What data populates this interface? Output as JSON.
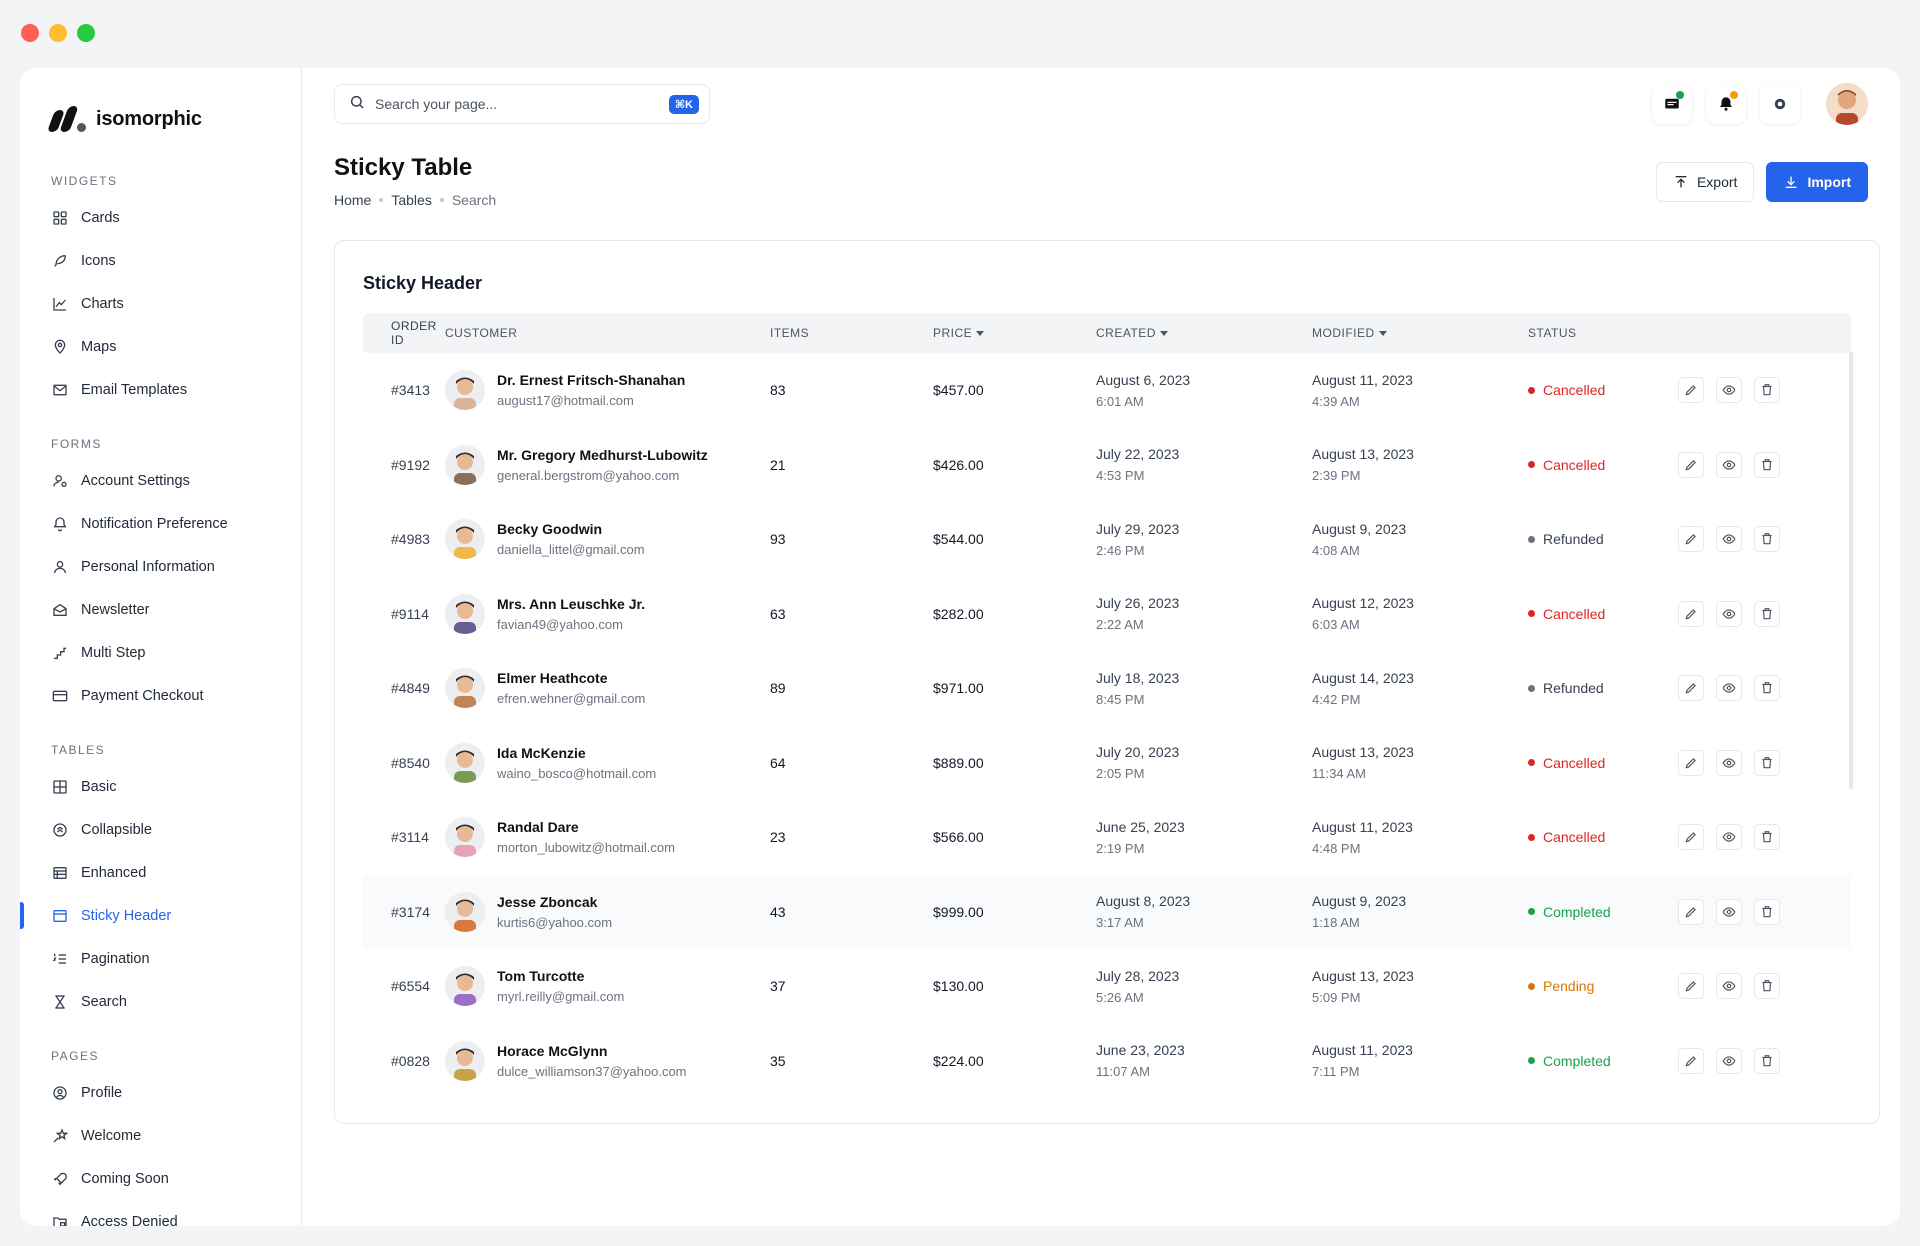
{
  "brand": {
    "name": "isomorphic"
  },
  "colors": {
    "accent": "#2563eb",
    "cancelled": "#dc2626",
    "refunded": "#6b7280",
    "completed": "#16a34a",
    "pending": "#d97706"
  },
  "sidebar": {
    "sections": [
      {
        "heading": "WIDGETS",
        "items": [
          {
            "label": "Cards",
            "icon": "grid-icon"
          },
          {
            "label": "Icons",
            "icon": "feather-icon"
          },
          {
            "label": "Charts",
            "icon": "chart-icon"
          },
          {
            "label": "Maps",
            "icon": "map-pin-icon"
          },
          {
            "label": "Email Templates",
            "icon": "mail-icon"
          }
        ]
      },
      {
        "heading": "FORMS",
        "items": [
          {
            "label": "Account Settings",
            "icon": "user-gear-icon"
          },
          {
            "label": "Notification Preference",
            "icon": "bell-icon"
          },
          {
            "label": "Personal Information",
            "icon": "user-icon"
          },
          {
            "label": "Newsletter",
            "icon": "envelope-open-icon"
          },
          {
            "label": "Multi Step",
            "icon": "steps-icon"
          },
          {
            "label": "Payment Checkout",
            "icon": "credit-card-icon"
          }
        ]
      },
      {
        "heading": "TABLES",
        "items": [
          {
            "label": "Basic",
            "icon": "table-icon"
          },
          {
            "label": "Collapsible",
            "icon": "collapse-icon"
          },
          {
            "label": "Enhanced",
            "icon": "table-list-icon"
          },
          {
            "label": "Sticky Header",
            "icon": "browser-icon",
            "active": true
          },
          {
            "label": "Pagination",
            "icon": "list-numbers-icon"
          },
          {
            "label": "Search",
            "icon": "hourglass-icon"
          }
        ]
      },
      {
        "heading": "PAGES",
        "items": [
          {
            "label": "Profile",
            "icon": "user-circle-icon"
          },
          {
            "label": "Welcome",
            "icon": "shooting-star-icon"
          },
          {
            "label": "Coming Soon",
            "icon": "rocket-icon"
          },
          {
            "label": "Access Denied",
            "icon": "folder-lock-icon"
          }
        ]
      }
    ]
  },
  "search": {
    "placeholder": "Search your page...",
    "shortcut": "⌘K"
  },
  "page": {
    "title": "Sticky Table",
    "breadcrumb": [
      "Home",
      "Tables",
      "Search"
    ],
    "export_label": "Export",
    "import_label": "Import"
  },
  "table": {
    "title": "Sticky Header",
    "columns": [
      "ORDER ID",
      "CUSTOMER",
      "ITEMS",
      "PRICE",
      "CREATED",
      "MODIFIED",
      "STATUS"
    ],
    "rows": [
      {
        "id": "#3413",
        "name": "Dr. Ernest Fritsch-Shanahan",
        "email": "august17@hotmail.com",
        "items": "83",
        "price": "$457.00",
        "created_date": "August 6, 2023",
        "created_time": "6:01 AM",
        "mod_date": "August 11, 2023",
        "mod_time": "4:39 AM",
        "status": "Cancelled",
        "status_color": "#dc2626",
        "avatar_color": "#d9b59a"
      },
      {
        "id": "#9192",
        "name": "Mr. Gregory Medhurst-Lubowitz",
        "email": "general.bergstrom@yahoo.com",
        "items": "21",
        "price": "$426.00",
        "created_date": "July 22, 2023",
        "created_time": "4:53 PM",
        "mod_date": "August 13, 2023",
        "mod_time": "2:39 PM",
        "status": "Cancelled",
        "status_color": "#dc2626",
        "avatar_color": "#8a6f5a"
      },
      {
        "id": "#4983",
        "name": "Becky Goodwin",
        "email": "daniella_littel@gmail.com",
        "items": "93",
        "price": "$544.00",
        "created_date": "July 29, 2023",
        "created_time": "2:46 PM",
        "mod_date": "August 9, 2023",
        "mod_time": "4:08 AM",
        "status": "Refunded",
        "status_color": "#6b7280",
        "avatar_color": "#f2b84b"
      },
      {
        "id": "#9114",
        "name": "Mrs. Ann Leuschke Jr.",
        "email": "favian49@yahoo.com",
        "items": "63",
        "price": "$282.00",
        "created_date": "July 26, 2023",
        "created_time": "2:22 AM",
        "mod_date": "August 12, 2023",
        "mod_time": "6:03 AM",
        "status": "Cancelled",
        "status_color": "#dc2626",
        "avatar_color": "#6b5b95"
      },
      {
        "id": "#4849",
        "name": "Elmer Heathcote",
        "email": "efren.wehner@gmail.com",
        "items": "89",
        "price": "$971.00",
        "created_date": "July 18, 2023",
        "created_time": "8:45 PM",
        "mod_date": "August 14, 2023",
        "mod_time": "4:42 PM",
        "status": "Refunded",
        "status_color": "#6b7280",
        "avatar_color": "#c08457"
      },
      {
        "id": "#8540",
        "name": "Ida McKenzie",
        "email": "waino_bosco@hotmail.com",
        "items": "64",
        "price": "$889.00",
        "created_date": "July 20, 2023",
        "created_time": "2:05 PM",
        "mod_date": "August 13, 2023",
        "mod_time": "11:34 AM",
        "status": "Cancelled",
        "status_color": "#dc2626",
        "avatar_color": "#7a9a56"
      },
      {
        "id": "#3114",
        "name": "Randal Dare",
        "email": "morton_lubowitz@hotmail.com",
        "items": "23",
        "price": "$566.00",
        "created_date": "June 25, 2023",
        "created_time": "2:19 PM",
        "mod_date": "August 11, 2023",
        "mod_time": "4:48 PM",
        "status": "Cancelled",
        "status_color": "#dc2626",
        "avatar_color": "#e6a3b8"
      },
      {
        "id": "#3174",
        "name": "Jesse Zboncak",
        "email": "kurtis6@yahoo.com",
        "items": "43",
        "price": "$999.00",
        "created_date": "August 8, 2023",
        "created_time": "3:17 AM",
        "mod_date": "August 9, 2023",
        "mod_time": "1:18 AM",
        "status": "Completed",
        "status_color": "#16a34a",
        "avatar_color": "#d9783f",
        "highlight": true
      },
      {
        "id": "#6554",
        "name": "Tom Turcotte",
        "email": "myrl.reilly@gmail.com",
        "items": "37",
        "price": "$130.00",
        "created_date": "July 28, 2023",
        "created_time": "5:26 AM",
        "mod_date": "August 13, 2023",
        "mod_time": "5:09 PM",
        "status": "Pending",
        "status_color": "#d97706",
        "avatar_color": "#9b6fc7"
      },
      {
        "id": "#0828",
        "name": "Horace McGlynn",
        "email": "dulce_williamson37@yahoo.com",
        "items": "35",
        "price": "$224.00",
        "created_date": "June 23, 2023",
        "created_time": "11:07 AM",
        "mod_date": "August 11, 2023",
        "mod_time": "7:11 PM",
        "status": "Completed",
        "status_color": "#16a34a",
        "avatar_color": "#c9a34a"
      }
    ]
  }
}
